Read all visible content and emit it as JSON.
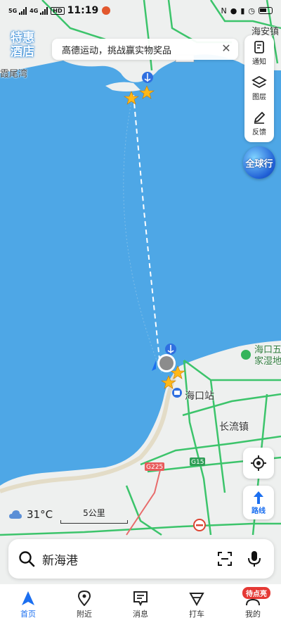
{
  "status_bar": {
    "signal1": "5G",
    "signal2": "4G",
    "hd": "HD",
    "time": "11:19"
  },
  "map": {
    "hotel_badge": "特惠酒店",
    "labels": {
      "top_right": "海安镇",
      "top_left": "霞尾湾",
      "haikou_station": "海口站",
      "changliu": "长流镇",
      "wetland": "海口五源\n家湿地",
      "road_g225": "G225",
      "road_g15": "G15"
    }
  },
  "promo": {
    "text": "高德运动，挑战赢实物奖品"
  },
  "tools": {
    "notify": "通知",
    "layers": "图层",
    "feedback": "反馈"
  },
  "globe": {
    "label": "全球行"
  },
  "route_button": {
    "label": "路线"
  },
  "weather": {
    "temp": "31°C"
  },
  "scale": {
    "label": "5公里"
  },
  "search": {
    "text": "新海港"
  },
  "nav": {
    "items": [
      {
        "label": "首页"
      },
      {
        "label": "附近"
      },
      {
        "label": "消息"
      },
      {
        "label": "打车"
      },
      {
        "label": "我的"
      }
    ],
    "badge": "待点亮"
  },
  "colors": {
    "sea": "#4ea7e6",
    "land": "#eef0ef",
    "road": "#3cc46b",
    "accent": "#1b6ff0"
  }
}
